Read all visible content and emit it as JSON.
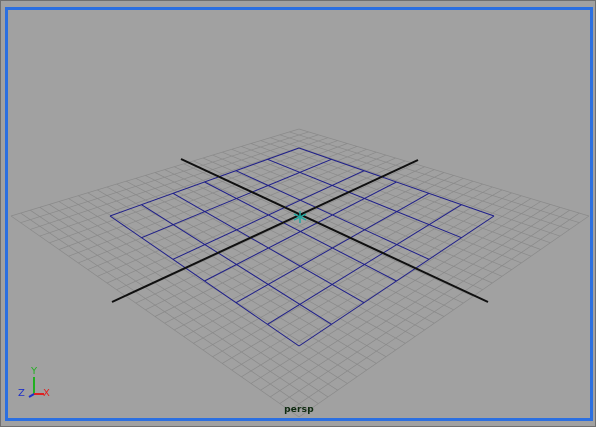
{
  "viewport": {
    "camera_name": "persp",
    "active_border_color": "#2b6fe0",
    "background_color": "#a1a1a1",
    "grid_color": "#8a8a8a",
    "subdivision_color": "#1f1f8a",
    "origin_axis_color": "#101010",
    "grid_visible": true
  },
  "axis_gizmo": {
    "y_label": "Y",
    "z_label": "Z",
    "x_label": "X",
    "colors": {
      "x": "#e02020",
      "y": "#20b020",
      "z": "#1e2fc8"
    }
  },
  "manipulator": {
    "icon": "origin-pivot-icon",
    "color": "#20a8a0"
  }
}
